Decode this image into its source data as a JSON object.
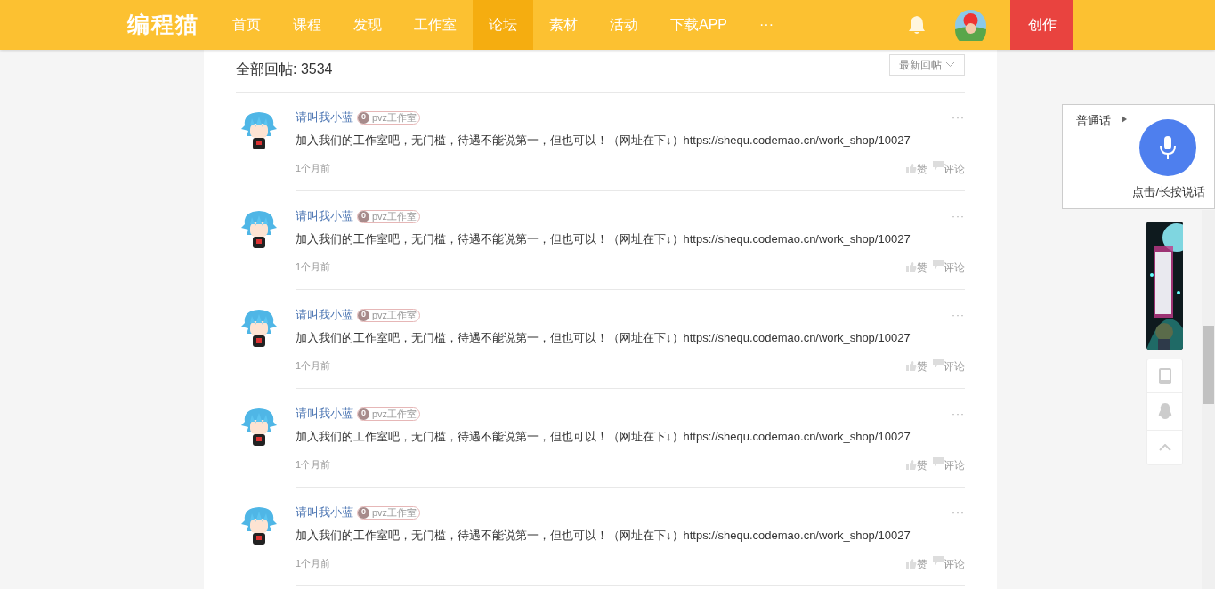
{
  "header": {
    "logo": "编程猫",
    "nav": [
      {
        "label": "首页",
        "selected": false
      },
      {
        "label": "课程",
        "selected": false
      },
      {
        "label": "发现",
        "selected": false
      },
      {
        "label": "工作室",
        "selected": false
      },
      {
        "label": "论坛",
        "selected": true
      },
      {
        "label": "素材",
        "selected": false
      },
      {
        "label": "活动",
        "selected": false
      },
      {
        "label": "下载APP",
        "selected": false
      },
      {
        "label": "···",
        "selected": false
      }
    ],
    "create_button": "创作"
  },
  "replies_header": {
    "title": "全部回帖: 3534",
    "sort": "最新回帖"
  },
  "replies": [
    {
      "author": "请叫我小蓝",
      "level": "0",
      "studio": "pvz工作室",
      "text": "加入我们的工作室吧，无门槛，待遇不能说第一，但也可以！（网址在下↓）https://shequ.codemao.cn/work_shop/10027",
      "time": "1个月前",
      "like": "赞",
      "comment": "评论",
      "more": "···"
    },
    {
      "author": "请叫我小蓝",
      "level": "0",
      "studio": "pvz工作室",
      "text": "加入我们的工作室吧，无门槛，待遇不能说第一，但也可以！（网址在下↓）https://shequ.codemao.cn/work_shop/10027",
      "time": "1个月前",
      "like": "赞",
      "comment": "评论",
      "more": "···"
    },
    {
      "author": "请叫我小蓝",
      "level": "0",
      "studio": "pvz工作室",
      "text": "加入我们的工作室吧，无门槛，待遇不能说第一，但也可以！（网址在下↓）https://shequ.codemao.cn/work_shop/10027",
      "time": "1个月前",
      "like": "赞",
      "comment": "评论",
      "more": "···"
    },
    {
      "author": "请叫我小蓝",
      "level": "0",
      "studio": "pvz工作室",
      "text": "加入我们的工作室吧，无门槛，待遇不能说第一，但也可以！（网址在下↓）https://shequ.codemao.cn/work_shop/10027",
      "time": "1个月前",
      "like": "赞",
      "comment": "评论",
      "more": "···"
    },
    {
      "author": "请叫我小蓝",
      "level": "0",
      "studio": "pvz工作室",
      "text": "加入我们的工作室吧，无门槛，待遇不能说第一，但也可以！（网址在下↓）https://shequ.codemao.cn/work_shop/10027",
      "time": "1个月前",
      "like": "赞",
      "comment": "评论",
      "more": "···"
    }
  ],
  "voice_widget": {
    "language": "普通话",
    "hint": "点击/长按说话"
  }
}
